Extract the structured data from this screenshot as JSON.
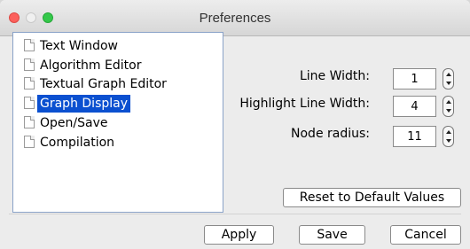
{
  "window": {
    "title": "Preferences"
  },
  "tree": {
    "items": [
      {
        "label": "Text Window",
        "selected": false
      },
      {
        "label": "Algorithm Editor",
        "selected": false
      },
      {
        "label": "Textual Graph Editor",
        "selected": false
      },
      {
        "label": "Graph Display",
        "selected": true
      },
      {
        "label": "Open/Save",
        "selected": false
      },
      {
        "label": "Compilation",
        "selected": false
      }
    ]
  },
  "settings": {
    "line_width": {
      "label": "Line Width:",
      "value": "1"
    },
    "highlight_line_width": {
      "label": "Highlight Line Width:",
      "value": "4"
    },
    "node_radius": {
      "label": "Node radius:",
      "value": "11"
    }
  },
  "buttons": {
    "reset_label": "Reset to Default Values",
    "apply_label": "Apply",
    "save_label": "Save",
    "cancel_label": "Cancel"
  },
  "colors": {
    "selection": "#0b50d0",
    "tree_border": "#8aa2c8",
    "close": "#fc605c",
    "zoom": "#34c84a"
  }
}
